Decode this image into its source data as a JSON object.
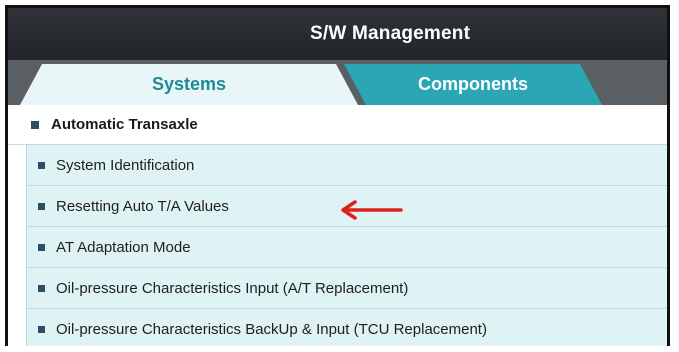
{
  "window": {
    "title": "S/W Management"
  },
  "tabs": [
    {
      "label": "Systems",
      "active": true
    },
    {
      "label": "Components",
      "active": false
    }
  ],
  "section": {
    "label": "Automatic Transaxle"
  },
  "items": [
    {
      "label": "System Identification"
    },
    {
      "label": "Resetting Auto T/A Values"
    },
    {
      "label": "AT Adaptation Mode"
    },
    {
      "label": "Oil-pressure Characteristics Input (A/T Replacement)"
    },
    {
      "label": "Oil-pressure Characteristics BackUp & Input (TCU Replacement)"
    }
  ],
  "annotation": {
    "icon": "left-arrow-icon",
    "color": "#e0201b",
    "points_to_item": "Resetting Auto T/A Values"
  },
  "colors": {
    "titlebar": "#2a2e32",
    "tabbar": "#5a5f63",
    "active_tab_bg": "#e9f6f7",
    "active_tab_text": "#1e8c98",
    "inactive_tab_bg": "#2aa6b4",
    "row_bg": "#dff2f4",
    "bullet": "#2a4f66"
  }
}
